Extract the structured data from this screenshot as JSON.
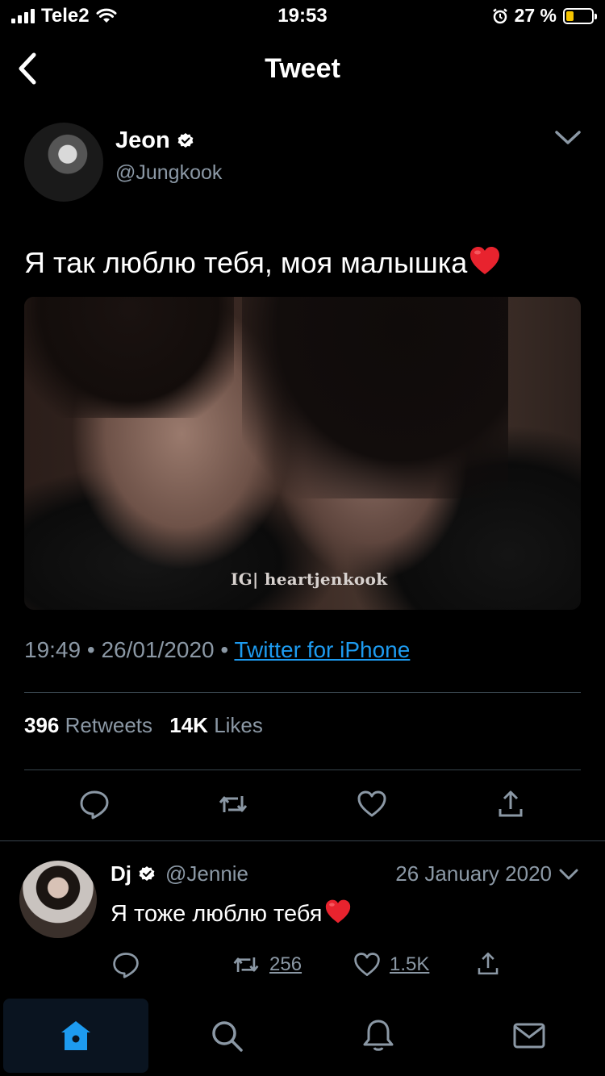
{
  "status_bar": {
    "carrier": "Tele2",
    "time": "19:53",
    "battery": "27 %"
  },
  "nav": {
    "title": "Tweet",
    "back_icon": "chevron-left-icon"
  },
  "tweet": {
    "author_name": "Jeon",
    "author_handle": "@Jungkook",
    "text": "Я так люблю тебя, моя малышка",
    "text_emoji": "red-heart",
    "media_watermark": "IG| heartjenkook",
    "time": "19:49",
    "date": "26/01/2020",
    "source": "Twitter for iPhone",
    "retweets_count": "396",
    "retweets_label": "Retweets",
    "likes_count": "14K",
    "likes_label": "Likes"
  },
  "reply": {
    "author_name": "Dj",
    "author_handle": "@Jennie",
    "date": "26 January 2020",
    "text": "Я тоже люблю тебя",
    "text_emoji": "red-heart",
    "retweet_count": "256",
    "like_count": "1.5K"
  },
  "tabbar": {
    "items": [
      "home-icon",
      "search-icon",
      "notifications-icon",
      "messages-icon"
    ],
    "active": "home-icon"
  },
  "colors": {
    "accent": "#1d9bf0",
    "muted": "#8b98a5",
    "divider": "#38444d",
    "background": "#000000"
  }
}
